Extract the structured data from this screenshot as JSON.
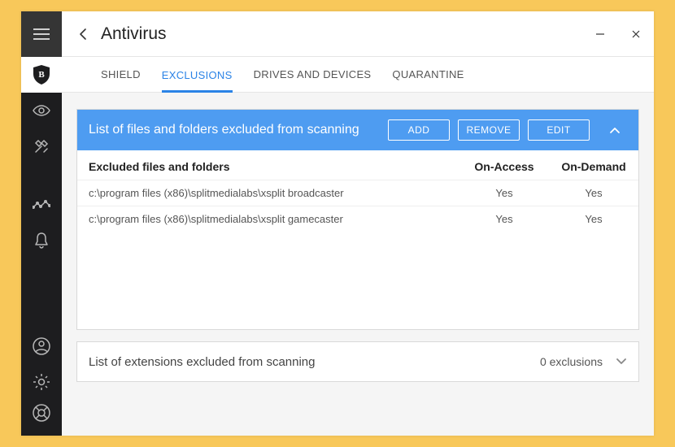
{
  "title": "Antivirus",
  "tabs": {
    "shield": "SHIELD",
    "exclusions": "EXCLUSIONS",
    "drives": "DRIVES AND DEVICES",
    "quarantine": "QUARANTINE"
  },
  "panel1": {
    "title": "List of files and folders excluded from scanning",
    "add": "ADD",
    "remove": "REMOVE",
    "edit": "EDIT",
    "columns": {
      "path": "Excluded files and folders",
      "onaccess": "On-Access",
      "ondemand": "On-Demand"
    },
    "rows": [
      {
        "path": "c:\\program files (x86)\\splitmedialabs\\xsplit broadcaster",
        "onaccess": "Yes",
        "ondemand": "Yes"
      },
      {
        "path": "c:\\program files (x86)\\splitmedialabs\\xsplit gamecaster",
        "onaccess": "Yes",
        "ondemand": "Yes"
      }
    ]
  },
  "panel2": {
    "title": "List of extensions excluded from scanning",
    "count": "0 exclusions"
  }
}
